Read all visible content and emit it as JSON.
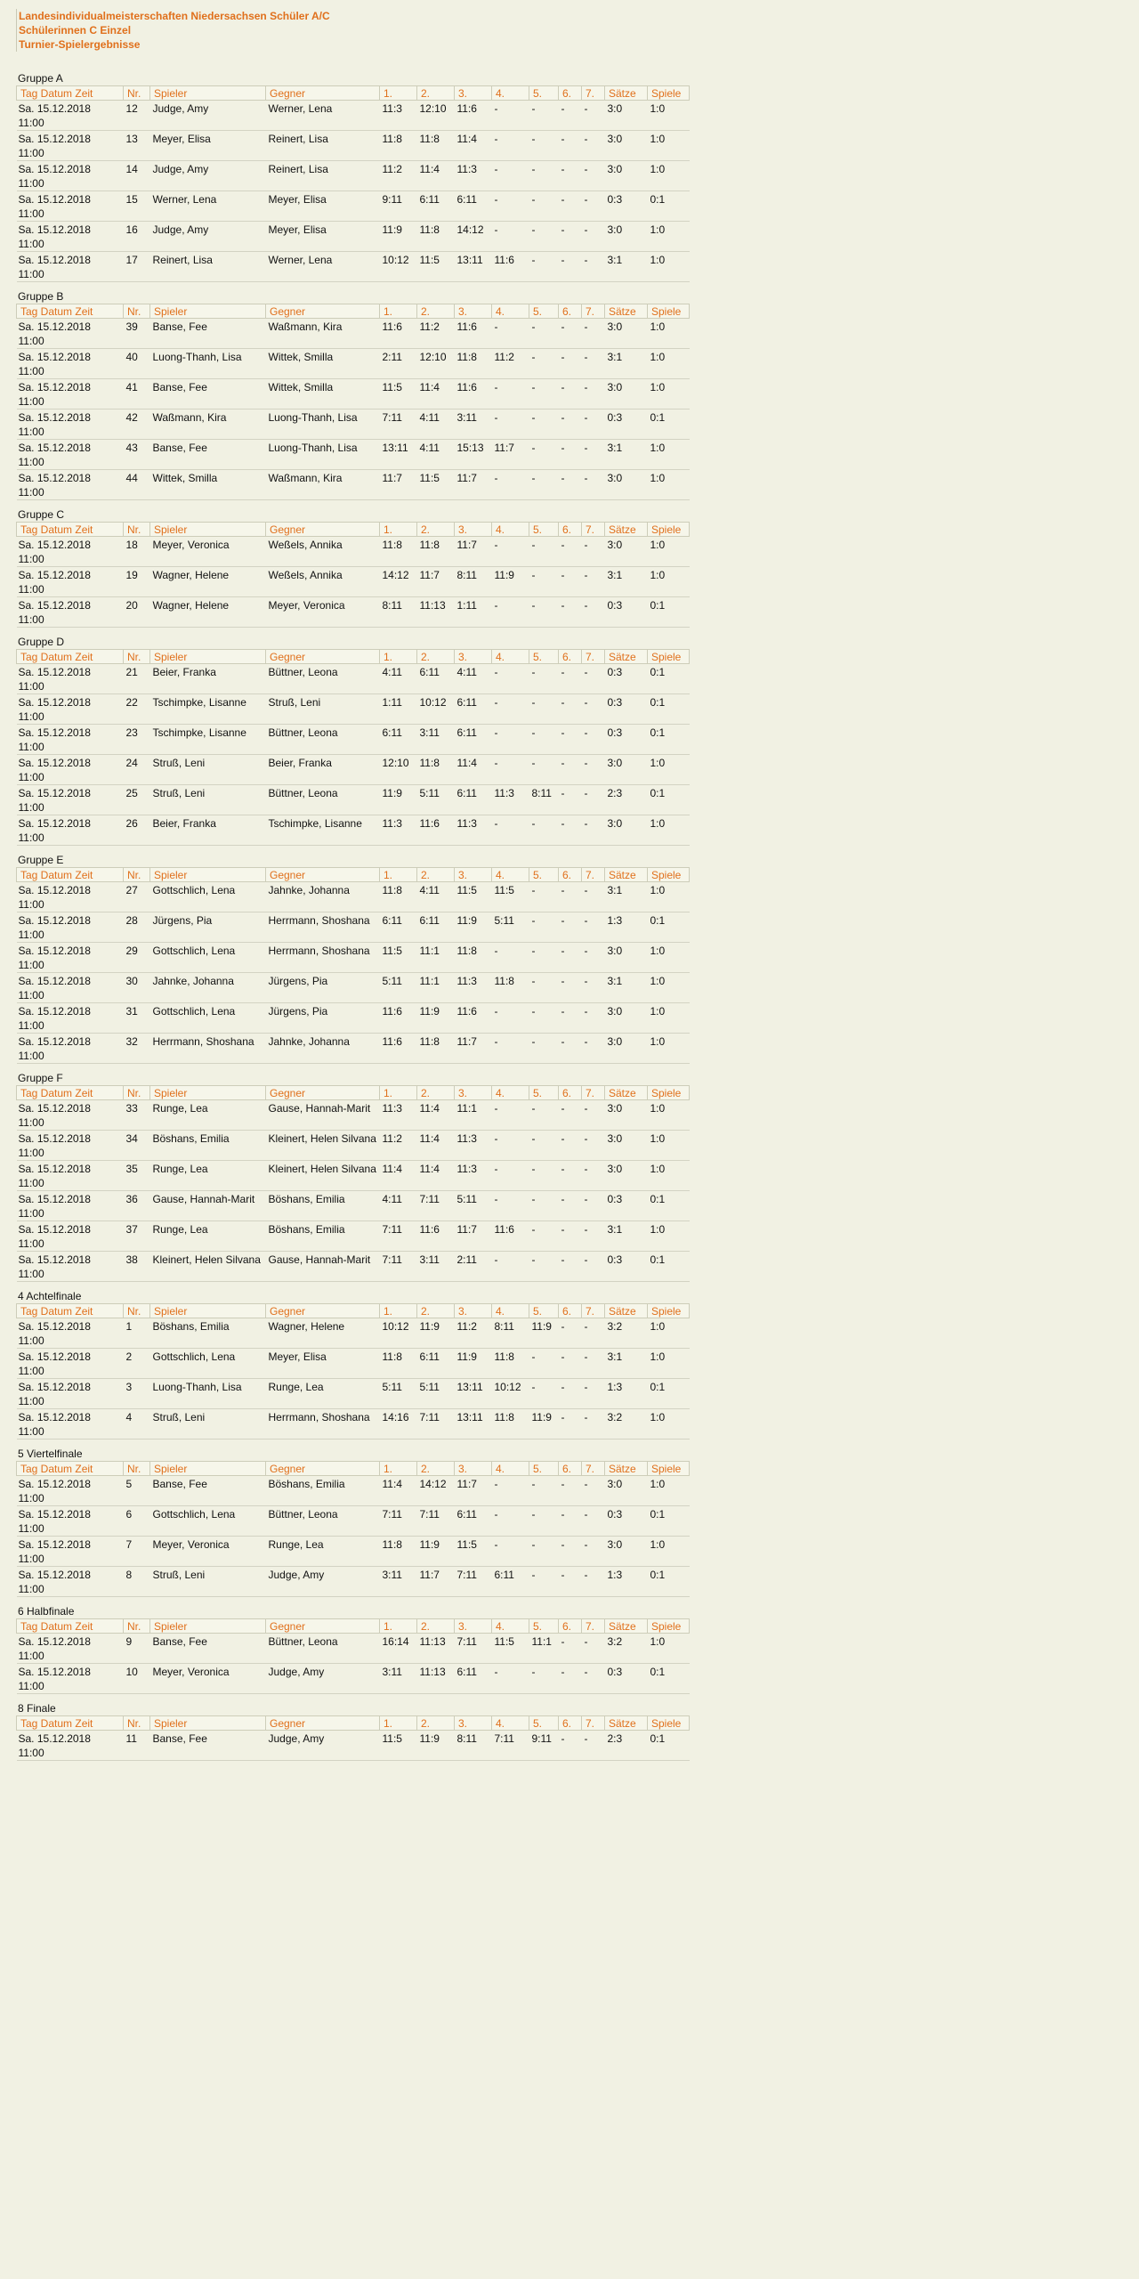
{
  "header": {
    "title": "Landesindividualmeisterschaften Niedersachsen Schüler A/C",
    "subtitle": "Schülerinnen C Einzel",
    "section": "Turnier-Spielergebnisse"
  },
  "columns": [
    "Tag Datum Zeit",
    "Nr.",
    "Spieler",
    "Gegner",
    "1.",
    "2.",
    "3.",
    "4.",
    "5.",
    "6.",
    "7.",
    "Sätze",
    "Spiele"
  ],
  "groups": [
    {
      "title": "Gruppe A",
      "rows": [
        {
          "date": "Sa. 15.12.2018",
          "time": "11:00",
          "nr": "12",
          "player": "Judge, Amy",
          "opponent": "Werner, Lena",
          "sets": [
            "11:3",
            "12:10",
            "11:6",
            "-",
            "-",
            "-",
            "-"
          ],
          "saetze": "3:0",
          "spiele": "1:0"
        },
        {
          "date": "Sa. 15.12.2018",
          "time": "11:00",
          "nr": "13",
          "player": "Meyer, Elisa",
          "opponent": "Reinert, Lisa",
          "sets": [
            "11:8",
            "11:8",
            "11:4",
            "-",
            "-",
            "-",
            "-"
          ],
          "saetze": "3:0",
          "spiele": "1:0"
        },
        {
          "date": "Sa. 15.12.2018",
          "time": "11:00",
          "nr": "14",
          "player": "Judge, Amy",
          "opponent": "Reinert, Lisa",
          "sets": [
            "11:2",
            "11:4",
            "11:3",
            "-",
            "-",
            "-",
            "-"
          ],
          "saetze": "3:0",
          "spiele": "1:0"
        },
        {
          "date": "Sa. 15.12.2018",
          "time": "11:00",
          "nr": "15",
          "player": "Werner, Lena",
          "opponent": "Meyer, Elisa",
          "sets": [
            "9:11",
            "6:11",
            "6:11",
            "-",
            "-",
            "-",
            "-"
          ],
          "saetze": "0:3",
          "spiele": "0:1"
        },
        {
          "date": "Sa. 15.12.2018",
          "time": "11:00",
          "nr": "16",
          "player": "Judge, Amy",
          "opponent": "Meyer, Elisa",
          "sets": [
            "11:9",
            "11:8",
            "14:12",
            "-",
            "-",
            "-",
            "-"
          ],
          "saetze": "3:0",
          "spiele": "1:0"
        },
        {
          "date": "Sa. 15.12.2018",
          "time": "11:00",
          "nr": "17",
          "player": "Reinert, Lisa",
          "opponent": "Werner, Lena",
          "sets": [
            "10:12",
            "11:5",
            "13:11",
            "11:6",
            "-",
            "-",
            "-"
          ],
          "saetze": "3:1",
          "spiele": "1:0"
        }
      ]
    },
    {
      "title": "Gruppe B",
      "rows": [
        {
          "date": "Sa. 15.12.2018",
          "time": "11:00",
          "nr": "39",
          "player": "Banse, Fee",
          "opponent": "Waßmann, Kira",
          "sets": [
            "11:6",
            "11:2",
            "11:6",
            "-",
            "-",
            "-",
            "-"
          ],
          "saetze": "3:0",
          "spiele": "1:0"
        },
        {
          "date": "Sa. 15.12.2018",
          "time": "11:00",
          "nr": "40",
          "player": "Luong-Thanh, Lisa",
          "opponent": "Wittek, Smilla",
          "sets": [
            "2:11",
            "12:10",
            "11:8",
            "11:2",
            "-",
            "-",
            "-"
          ],
          "saetze": "3:1",
          "spiele": "1:0"
        },
        {
          "date": "Sa. 15.12.2018",
          "time": "11:00",
          "nr": "41",
          "player": "Banse, Fee",
          "opponent": "Wittek, Smilla",
          "sets": [
            "11:5",
            "11:4",
            "11:6",
            "-",
            "-",
            "-",
            "-"
          ],
          "saetze": "3:0",
          "spiele": "1:0"
        },
        {
          "date": "Sa. 15.12.2018",
          "time": "11:00",
          "nr": "42",
          "player": "Waßmann, Kira",
          "opponent": "Luong-Thanh, Lisa",
          "sets": [
            "7:11",
            "4:11",
            "3:11",
            "-",
            "-",
            "-",
            "-"
          ],
          "saetze": "0:3",
          "spiele": "0:1"
        },
        {
          "date": "Sa. 15.12.2018",
          "time": "11:00",
          "nr": "43",
          "player": "Banse, Fee",
          "opponent": "Luong-Thanh, Lisa",
          "sets": [
            "13:11",
            "4:11",
            "15:13",
            "11:7",
            "-",
            "-",
            "-"
          ],
          "saetze": "3:1",
          "spiele": "1:0"
        },
        {
          "date": "Sa. 15.12.2018",
          "time": "11:00",
          "nr": "44",
          "player": "Wittek, Smilla",
          "opponent": "Waßmann, Kira",
          "sets": [
            "11:7",
            "11:5",
            "11:7",
            "-",
            "-",
            "-",
            "-"
          ],
          "saetze": "3:0",
          "spiele": "1:0"
        }
      ]
    },
    {
      "title": "Gruppe C",
      "rows": [
        {
          "date": "Sa. 15.12.2018",
          "time": "11:00",
          "nr": "18",
          "player": "Meyer, Veronica",
          "opponent": "Weßels, Annika",
          "sets": [
            "11:8",
            "11:8",
            "11:7",
            "-",
            "-",
            "-",
            "-"
          ],
          "saetze": "3:0",
          "spiele": "1:0"
        },
        {
          "date": "Sa. 15.12.2018",
          "time": "11:00",
          "nr": "19",
          "player": "Wagner, Helene",
          "opponent": "Weßels, Annika",
          "sets": [
            "14:12",
            "11:7",
            "8:11",
            "11:9",
            "-",
            "-",
            "-"
          ],
          "saetze": "3:1",
          "spiele": "1:0"
        },
        {
          "date": "Sa. 15.12.2018",
          "time": "11:00",
          "nr": "20",
          "player": "Wagner, Helene",
          "opponent": "Meyer, Veronica",
          "sets": [
            "8:11",
            "11:13",
            "1:11",
            "-",
            "-",
            "-",
            "-"
          ],
          "saetze": "0:3",
          "spiele": "0:1"
        }
      ]
    },
    {
      "title": "Gruppe D",
      "rows": [
        {
          "date": "Sa. 15.12.2018",
          "time": "11:00",
          "nr": "21",
          "player": "Beier, Franka",
          "opponent": "Büttner, Leona",
          "sets": [
            "4:11",
            "6:11",
            "4:11",
            "-",
            "-",
            "-",
            "-"
          ],
          "saetze": "0:3",
          "spiele": "0:1"
        },
        {
          "date": "Sa. 15.12.2018",
          "time": "11:00",
          "nr": "22",
          "player": "Tschimpke, Lisanne",
          "opponent": "Struß, Leni",
          "sets": [
            "1:11",
            "10:12",
            "6:11",
            "-",
            "-",
            "-",
            "-"
          ],
          "saetze": "0:3",
          "spiele": "0:1"
        },
        {
          "date": "Sa. 15.12.2018",
          "time": "11:00",
          "nr": "23",
          "player": "Tschimpke, Lisanne",
          "opponent": "Büttner, Leona",
          "sets": [
            "6:11",
            "3:11",
            "6:11",
            "-",
            "-",
            "-",
            "-"
          ],
          "saetze": "0:3",
          "spiele": "0:1"
        },
        {
          "date": "Sa. 15.12.2018",
          "time": "11:00",
          "nr": "24",
          "player": "Struß, Leni",
          "opponent": "Beier, Franka",
          "sets": [
            "12:10",
            "11:8",
            "11:4",
            "-",
            "-",
            "-",
            "-"
          ],
          "saetze": "3:0",
          "spiele": "1:0"
        },
        {
          "date": "Sa. 15.12.2018",
          "time": "11:00",
          "nr": "25",
          "player": "Struß, Leni",
          "opponent": "Büttner, Leona",
          "sets": [
            "11:9",
            "5:11",
            "6:11",
            "11:3",
            "8:11",
            "-",
            "-"
          ],
          "saetze": "2:3",
          "spiele": "0:1"
        },
        {
          "date": "Sa. 15.12.2018",
          "time": "11:00",
          "nr": "26",
          "player": "Beier, Franka",
          "opponent": "Tschimpke, Lisanne",
          "sets": [
            "11:3",
            "11:6",
            "11:3",
            "-",
            "-",
            "-",
            "-"
          ],
          "saetze": "3:0",
          "spiele": "1:0"
        }
      ]
    },
    {
      "title": "Gruppe E",
      "rows": [
        {
          "date": "Sa. 15.12.2018",
          "time": "11:00",
          "nr": "27",
          "player": "Gottschlich, Lena",
          "opponent": "Jahnke, Johanna",
          "sets": [
            "11:8",
            "4:11",
            "11:5",
            "11:5",
            "-",
            "-",
            "-"
          ],
          "saetze": "3:1",
          "spiele": "1:0"
        },
        {
          "date": "Sa. 15.12.2018",
          "time": "11:00",
          "nr": "28",
          "player": "Jürgens, Pia",
          "opponent": "Herrmann, Shoshana",
          "sets": [
            "6:11",
            "6:11",
            "11:9",
            "5:11",
            "-",
            "-",
            "-"
          ],
          "saetze": "1:3",
          "spiele": "0:1"
        },
        {
          "date": "Sa. 15.12.2018",
          "time": "11:00",
          "nr": "29",
          "player": "Gottschlich, Lena",
          "opponent": "Herrmann, Shoshana",
          "sets": [
            "11:5",
            "11:1",
            "11:8",
            "-",
            "-",
            "-",
            "-"
          ],
          "saetze": "3:0",
          "spiele": "1:0"
        },
        {
          "date": "Sa. 15.12.2018",
          "time": "11:00",
          "nr": "30",
          "player": "Jahnke, Johanna",
          "opponent": "Jürgens, Pia",
          "sets": [
            "5:11",
            "11:1",
            "11:3",
            "11:8",
            "-",
            "-",
            "-"
          ],
          "saetze": "3:1",
          "spiele": "1:0"
        },
        {
          "date": "Sa. 15.12.2018",
          "time": "11:00",
          "nr": "31",
          "player": "Gottschlich, Lena",
          "opponent": "Jürgens, Pia",
          "sets": [
            "11:6",
            "11:9",
            "11:6",
            "-",
            "-",
            "-",
            "-"
          ],
          "saetze": "3:0",
          "spiele": "1:0"
        },
        {
          "date": "Sa. 15.12.2018",
          "time": "11:00",
          "nr": "32",
          "player": "Herrmann, Shoshana",
          "opponent": "Jahnke, Johanna",
          "sets": [
            "11:6",
            "11:8",
            "11:7",
            "-",
            "-",
            "-",
            "-"
          ],
          "saetze": "3:0",
          "spiele": "1:0"
        }
      ]
    },
    {
      "title": "Gruppe F",
      "rows": [
        {
          "date": "Sa. 15.12.2018",
          "time": "11:00",
          "nr": "33",
          "player": "Runge, Lea",
          "opponent": "Gause, Hannah-Marit",
          "sets": [
            "11:3",
            "11:4",
            "11:1",
            "-",
            "-",
            "-",
            "-"
          ],
          "saetze": "3:0",
          "spiele": "1:0"
        },
        {
          "date": "Sa. 15.12.2018",
          "time": "11:00",
          "nr": "34",
          "player": "Böshans, Emilia",
          "opponent": "Kleinert, Helen Silvana",
          "sets": [
            "11:2",
            "11:4",
            "11:3",
            "-",
            "-",
            "-",
            "-"
          ],
          "saetze": "3:0",
          "spiele": "1:0"
        },
        {
          "date": "Sa. 15.12.2018",
          "time": "11:00",
          "nr": "35",
          "player": "Runge, Lea",
          "opponent": "Kleinert, Helen Silvana",
          "sets": [
            "11:4",
            "11:4",
            "11:3",
            "-",
            "-",
            "-",
            "-"
          ],
          "saetze": "3:0",
          "spiele": "1:0"
        },
        {
          "date": "Sa. 15.12.2018",
          "time": "11:00",
          "nr": "36",
          "player": "Gause, Hannah-Marit",
          "opponent": "Böshans, Emilia",
          "sets": [
            "4:11",
            "7:11",
            "5:11",
            "-",
            "-",
            "-",
            "-"
          ],
          "saetze": "0:3",
          "spiele": "0:1"
        },
        {
          "date": "Sa. 15.12.2018",
          "time": "11:00",
          "nr": "37",
          "player": "Runge, Lea",
          "opponent": "Böshans, Emilia",
          "sets": [
            "7:11",
            "11:6",
            "11:7",
            "11:6",
            "-",
            "-",
            "-"
          ],
          "saetze": "3:1",
          "spiele": "1:0"
        },
        {
          "date": "Sa. 15.12.2018",
          "time": "11:00",
          "nr": "38",
          "player": "Kleinert, Helen Silvana",
          "opponent": "Gause, Hannah-Marit",
          "sets": [
            "7:11",
            "3:11",
            "2:11",
            "-",
            "-",
            "-",
            "-"
          ],
          "saetze": "0:3",
          "spiele": "0:1"
        }
      ]
    },
    {
      "title": "4 Achtelfinale",
      "rows": [
        {
          "date": "Sa. 15.12.2018",
          "time": "11:00",
          "nr": "1",
          "player": "Böshans, Emilia",
          "opponent": "Wagner, Helene",
          "sets": [
            "10:12",
            "11:9",
            "11:2",
            "8:11",
            "11:9",
            "-",
            "-"
          ],
          "saetze": "3:2",
          "spiele": "1:0"
        },
        {
          "date": "Sa. 15.12.2018",
          "time": "11:00",
          "nr": "2",
          "player": "Gottschlich, Lena",
          "opponent": "Meyer, Elisa",
          "sets": [
            "11:8",
            "6:11",
            "11:9",
            "11:8",
            "-",
            "-",
            "-"
          ],
          "saetze": "3:1",
          "spiele": "1:0"
        },
        {
          "date": "Sa. 15.12.2018",
          "time": "11:00",
          "nr": "3",
          "player": "Luong-Thanh, Lisa",
          "opponent": "Runge, Lea",
          "sets": [
            "5:11",
            "5:11",
            "13:11",
            "10:12",
            "-",
            "-",
            "-"
          ],
          "saetze": "1:3",
          "spiele": "0:1"
        },
        {
          "date": "Sa. 15.12.2018",
          "time": "11:00",
          "nr": "4",
          "player": "Struß, Leni",
          "opponent": "Herrmann, Shoshana",
          "sets": [
            "14:16",
            "7:11",
            "13:11",
            "11:8",
            "11:9",
            "-",
            "-"
          ],
          "saetze": "3:2",
          "spiele": "1:0"
        }
      ]
    },
    {
      "title": "5 Viertelfinale",
      "rows": [
        {
          "date": "Sa. 15.12.2018",
          "time": "11:00",
          "nr": "5",
          "player": "Banse, Fee",
          "opponent": "Böshans, Emilia",
          "sets": [
            "11:4",
            "14:12",
            "11:7",
            "-",
            "-",
            "-",
            "-"
          ],
          "saetze": "3:0",
          "spiele": "1:0"
        },
        {
          "date": "Sa. 15.12.2018",
          "time": "11:00",
          "nr": "6",
          "player": "Gottschlich, Lena",
          "opponent": "Büttner, Leona",
          "sets": [
            "7:11",
            "7:11",
            "6:11",
            "-",
            "-",
            "-",
            "-"
          ],
          "saetze": "0:3",
          "spiele": "0:1"
        },
        {
          "date": "Sa. 15.12.2018",
          "time": "11:00",
          "nr": "7",
          "player": "Meyer, Veronica",
          "opponent": "Runge, Lea",
          "sets": [
            "11:8",
            "11:9",
            "11:5",
            "-",
            "-",
            "-",
            "-"
          ],
          "saetze": "3:0",
          "spiele": "1:0"
        },
        {
          "date": "Sa. 15.12.2018",
          "time": "11:00",
          "nr": "8",
          "player": "Struß, Leni",
          "opponent": "Judge, Amy",
          "sets": [
            "3:11",
            "11:7",
            "7:11",
            "6:11",
            "-",
            "-",
            "-"
          ],
          "saetze": "1:3",
          "spiele": "0:1"
        }
      ]
    },
    {
      "title": "6 Halbfinale",
      "rows": [
        {
          "date": "Sa. 15.12.2018",
          "time": "11:00",
          "nr": "9",
          "player": "Banse, Fee",
          "opponent": "Büttner, Leona",
          "sets": [
            "16:14",
            "11:13",
            "7:11",
            "11:5",
            "11:1",
            "-",
            "-"
          ],
          "saetze": "3:2",
          "spiele": "1:0"
        },
        {
          "date": "Sa. 15.12.2018",
          "time": "11:00",
          "nr": "10",
          "player": "Meyer, Veronica",
          "opponent": "Judge, Amy",
          "sets": [
            "3:11",
            "11:13",
            "6:11",
            "-",
            "-",
            "-",
            "-"
          ],
          "saetze": "0:3",
          "spiele": "0:1"
        }
      ]
    },
    {
      "title": "8 Finale",
      "rows": [
        {
          "date": "Sa. 15.12.2018",
          "time": "11:00",
          "nr": "11",
          "player": "Banse, Fee",
          "opponent": "Judge, Amy",
          "sets": [
            "11:5",
            "11:9",
            "8:11",
            "7:11",
            "9:11",
            "-",
            "-"
          ],
          "saetze": "2:3",
          "spiele": "0:1"
        }
      ]
    }
  ]
}
